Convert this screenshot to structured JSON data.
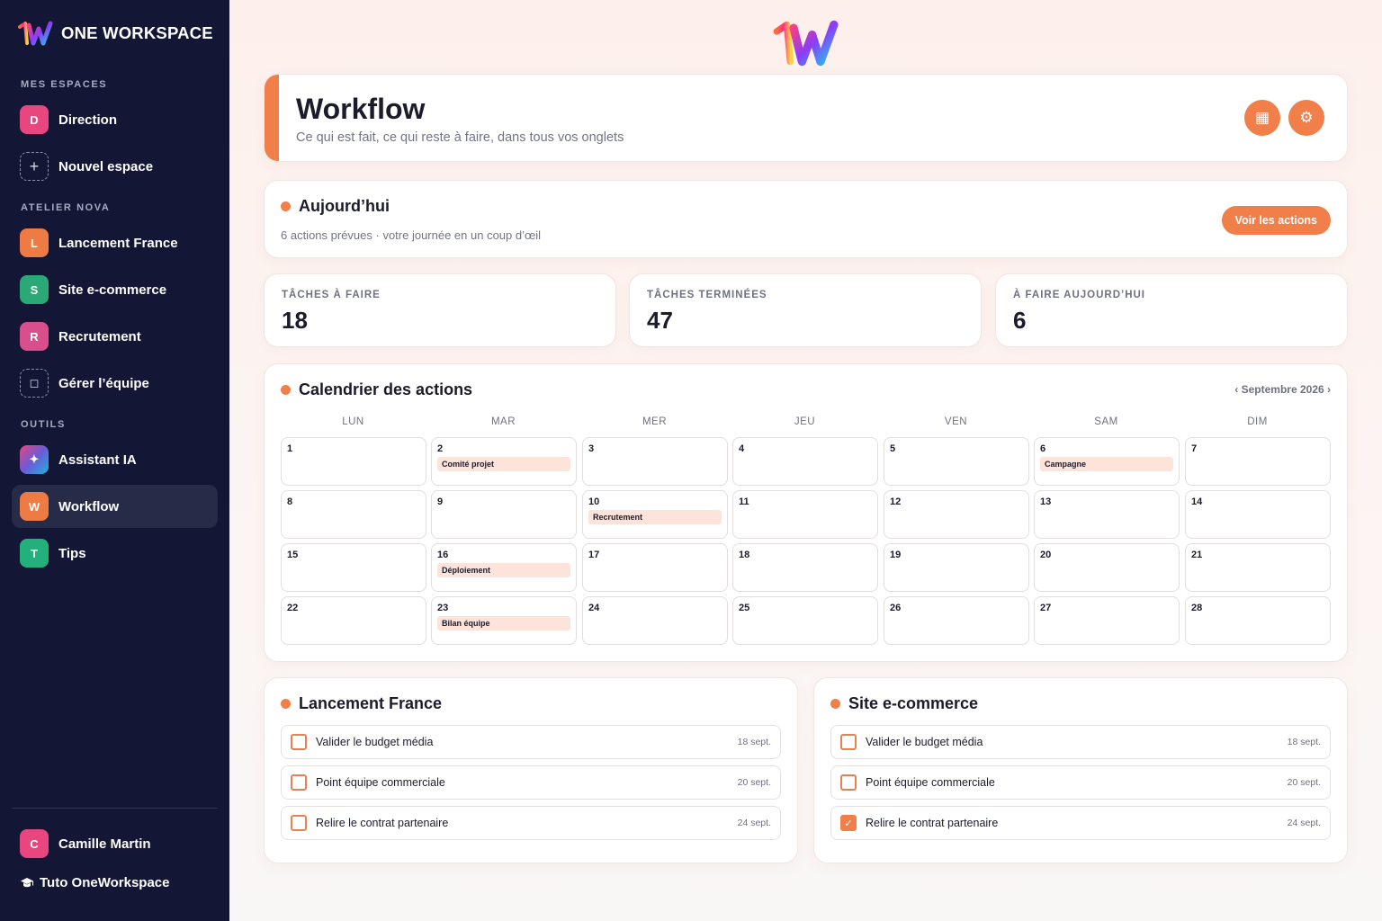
{
  "brand": {
    "name": "ONE WORKSPACE"
  },
  "sidebar": {
    "sections": {
      "mes_espaces": "MES ESPACES",
      "atelier_nova": "ATELIER NOVA",
      "outils": "OUTILS"
    },
    "items": [
      {
        "letter": "D",
        "label": "Direction",
        "color": "#e8467f"
      },
      {
        "letter": "+",
        "label": "Nouvel espace"
      },
      {
        "letter": "L",
        "label": "Lancement France",
        "color": "#ee7a44"
      },
      {
        "letter": "S",
        "label": "Site e-commerce",
        "color": "#2aa876"
      },
      {
        "letter": "R",
        "label": "Recrutement",
        "color": "#d94f8c"
      },
      {
        "letter": "◻",
        "label": "Gérer l’équipe"
      },
      {
        "letter": "✦",
        "label": "Assistant IA"
      },
      {
        "letter": "W",
        "label": "Workflow",
        "color": "#ee7a44"
      },
      {
        "letter": "T",
        "label": "Tips",
        "color": "#23b07a"
      }
    ],
    "user": {
      "letter": "C",
      "name": "Camille Martin",
      "color": "#e8467f"
    },
    "tuto": {
      "icon": "graduation-cap-icon",
      "label": "Tuto OneWorkspace"
    }
  },
  "header": {
    "title": "Workflow",
    "subtitle": "Ce qui est fait, ce qui reste à faire, dans tous vos onglets",
    "buttons": [
      {
        "icon": "calendar-icon",
        "glyph": "▦"
      },
      {
        "icon": "gear-icon",
        "glyph": "⚙"
      }
    ]
  },
  "today": {
    "title": "Aujourd’hui",
    "subtitle": "6 actions prévues · votre journée en un coup d’œil",
    "button": "Voir les actions"
  },
  "stats": [
    {
      "label": "TÂCHES À FAIRE",
      "value": "18"
    },
    {
      "label": "TÂCHES TERMINÉES",
      "value": "47"
    },
    {
      "label": "À FAIRE AUJOURD’HUI",
      "value": "6"
    }
  ],
  "calendar": {
    "title": "Calendrier des actions",
    "month_nav": "‹ Septembre 2026 ›",
    "weekdays": [
      "LUN",
      "MAR",
      "MER",
      "JEU",
      "VEN",
      "SAM",
      "DIM"
    ],
    "days": [
      {
        "n": "1",
        "event": ""
      },
      {
        "n": "2",
        "event": "Comité projet"
      },
      {
        "n": "3",
        "event": ""
      },
      {
        "n": "4",
        "event": ""
      },
      {
        "n": "5",
        "event": ""
      },
      {
        "n": "6",
        "event": "Campagne"
      },
      {
        "n": "7",
        "event": ""
      },
      {
        "n": "8",
        "event": ""
      },
      {
        "n": "9",
        "event": ""
      },
      {
        "n": "10",
        "event": "Recrutement"
      },
      {
        "n": "11",
        "event": ""
      },
      {
        "n": "12",
        "event": ""
      },
      {
        "n": "13",
        "event": ""
      },
      {
        "n": "14",
        "event": ""
      },
      {
        "n": "15",
        "event": ""
      },
      {
        "n": "16",
        "event": "Déploiement"
      },
      {
        "n": "17",
        "event": ""
      },
      {
        "n": "18",
        "event": ""
      },
      {
        "n": "19",
        "event": ""
      },
      {
        "n": "20",
        "event": ""
      },
      {
        "n": "21",
        "event": ""
      },
      {
        "n": "22",
        "event": ""
      },
      {
        "n": "23",
        "event": "Bilan équipe"
      },
      {
        "n": "24",
        "event": ""
      },
      {
        "n": "25",
        "event": ""
      },
      {
        "n": "26",
        "event": ""
      },
      {
        "n": "27",
        "event": ""
      },
      {
        "n": "28",
        "event": ""
      }
    ]
  },
  "task_lists": [
    {
      "title": "Lancement France",
      "tasks": [
        {
          "label": "Valider le budget média",
          "date": "18 sept.",
          "done": false
        },
        {
          "label": "Point équipe commerciale",
          "date": "20 sept.",
          "done": false
        },
        {
          "label": "Relire le contrat partenaire",
          "date": "24 sept.",
          "done": false
        }
      ]
    },
    {
      "title": "Site e-commerce",
      "tasks": [
        {
          "label": "Valider le budget média",
          "date": "18 sept.",
          "done": false
        },
        {
          "label": "Point équipe commerciale",
          "date": "20 sept.",
          "done": false
        },
        {
          "label": "Relire le contrat partenaire",
          "date": "24 sept.",
          "done": true
        }
      ]
    }
  ],
  "colors": {
    "accent": "#f07f4a",
    "sidebar_bg": "#131735",
    "active_item_bg": "#262b48",
    "event_bg": "#fde3da"
  }
}
